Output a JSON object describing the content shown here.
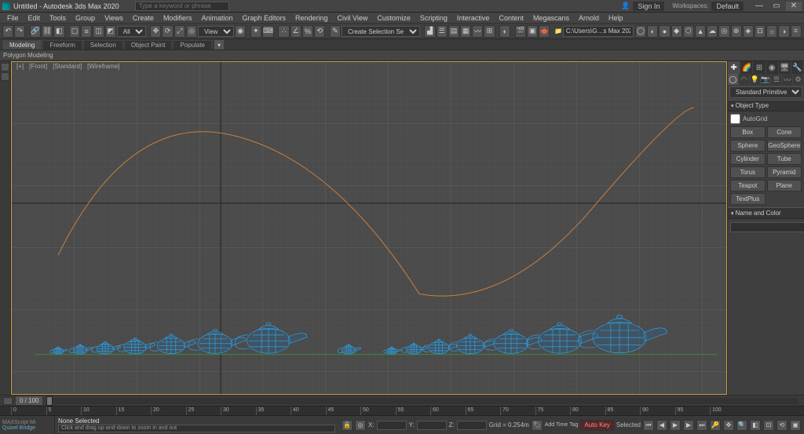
{
  "title": "Untitled - Autodesk 3ds Max 2020",
  "signin": "Sign In",
  "workspaces_label": "Workspaces:",
  "workspace": "Default",
  "type_keyword_placeholder": "Type a keyword or phrase",
  "menu": [
    "File",
    "Edit",
    "Tools",
    "Group",
    "Views",
    "Create",
    "Modifiers",
    "Animation",
    "Graph Editors",
    "Rendering",
    "Civil View",
    "Customize",
    "Scripting",
    "Interactive",
    "Content",
    "Megascans",
    "Arnold",
    "Help"
  ],
  "selection_mode": "Create Selection Se",
  "project_path": "C:\\Users\\G…s Max 2020",
  "ribbon_tabs": [
    "Modeling",
    "Freeform",
    "Selection",
    "Object Paint",
    "Populate"
  ],
  "ribbon_active": 0,
  "ribbon_strip": "Polygon Modeling",
  "viewport_labels": [
    "[+]",
    "[Front]",
    "[Standard]",
    "[Wireframe]"
  ],
  "command_panel": {
    "category": "Standard Primitives",
    "rollout_objtype": "Object Type",
    "autogrid": "AutoGrid",
    "buttons": [
      "Box",
      "Cone",
      "Sphere",
      "GeoSphere",
      "Cylinder",
      "Tube",
      "Torus",
      "Pyramid",
      "Teapot",
      "Plane",
      "TextPlus",
      ""
    ],
    "rollout_namecolor": "Name and Color",
    "object_name": ""
  },
  "time": {
    "frame": "0 / 100",
    "ticks": [
      0,
      5,
      10,
      15,
      20,
      25,
      30,
      35,
      40,
      45,
      50,
      55,
      60,
      65,
      70,
      75,
      80,
      85,
      90,
      95,
      100
    ]
  },
  "status": {
    "bridge": "Quixel Bridge",
    "selection": "None Selected",
    "prompt": "Click and drag up-and-down to zoom in and out",
    "autokey": "Auto Key",
    "setkey": "Selected",
    "grid": "Grid = 0.254m",
    "addtag": "Add Time Tag",
    "x": "",
    "y": "",
    "z": ""
  }
}
